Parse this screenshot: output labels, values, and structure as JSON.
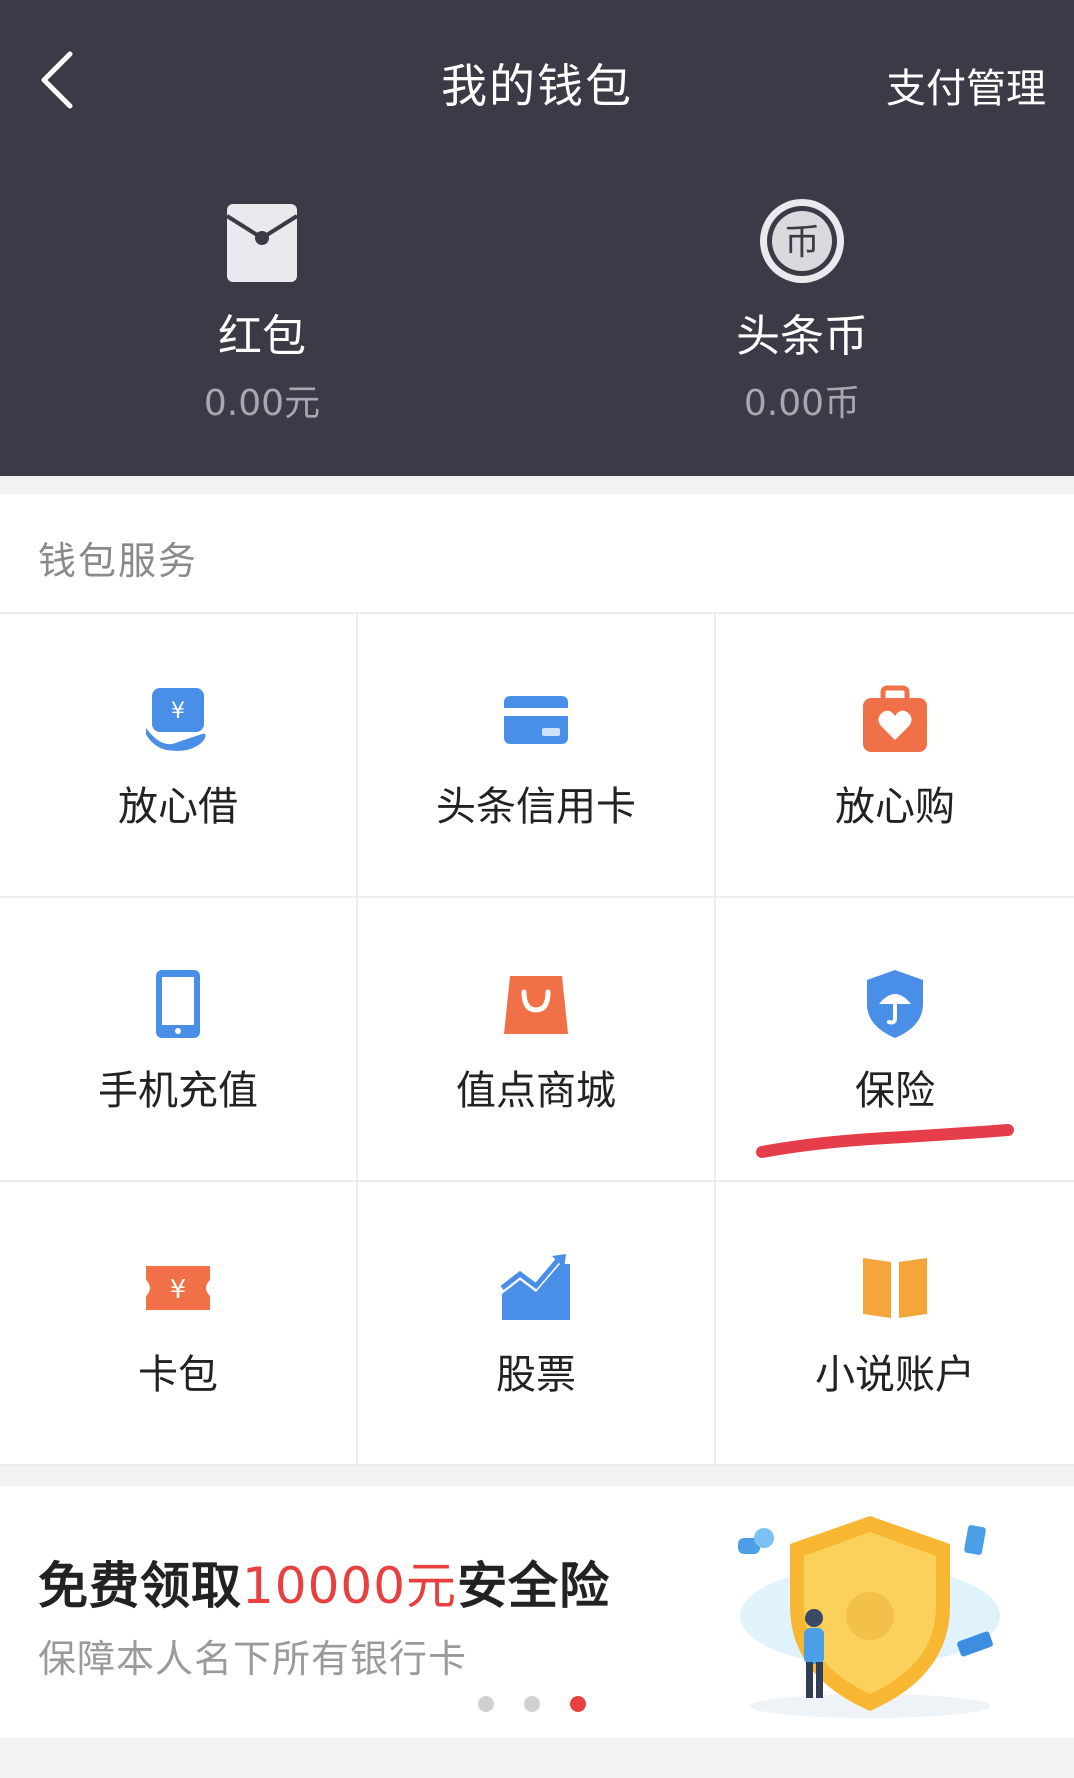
{
  "header": {
    "title": "我的钱包",
    "action": "支付管理",
    "assets": [
      {
        "name": "红包",
        "value": "0.00元",
        "icon": "red-envelope-icon"
      },
      {
        "name": "头条币",
        "value": "0.00币",
        "icon": "coin-icon",
        "coin_glyph": "币"
      }
    ]
  },
  "services": {
    "title": "钱包服务",
    "items": [
      {
        "label": "放心借",
        "icon": "loan-icon",
        "color": "#4a8fe7"
      },
      {
        "label": "头条信用卡",
        "icon": "credit-card-icon",
        "color": "#4a8fe7"
      },
      {
        "label": "放心购",
        "icon": "shopping-bag-heart-icon",
        "color": "#f07048"
      },
      {
        "label": "手机充值",
        "icon": "phone-icon",
        "color": "#4a8fe7"
      },
      {
        "label": "值点商城",
        "icon": "mall-bag-icon",
        "color": "#f07048"
      },
      {
        "label": "保险",
        "icon": "shield-umbrella-icon",
        "color": "#4a8fe7"
      },
      {
        "label": "卡包",
        "icon": "ticket-icon",
        "color": "#f07048"
      },
      {
        "label": "股票",
        "icon": "stock-chart-icon",
        "color": "#4a8fe7"
      },
      {
        "label": "小说账户",
        "icon": "book-icon",
        "color": "#f5a53a"
      }
    ]
  },
  "banner": {
    "title_prefix": "免费领取",
    "title_highlight": "10000元",
    "title_suffix": "安全险",
    "subtitle": "保障本人名下所有银行卡",
    "page_count": 3,
    "active_page": 3,
    "highlight_color": "#e8403f"
  },
  "colors": {
    "header_bg": "#3a3b46",
    "accent_red": "#e8403f",
    "annotation_red": "#e63d4a"
  }
}
